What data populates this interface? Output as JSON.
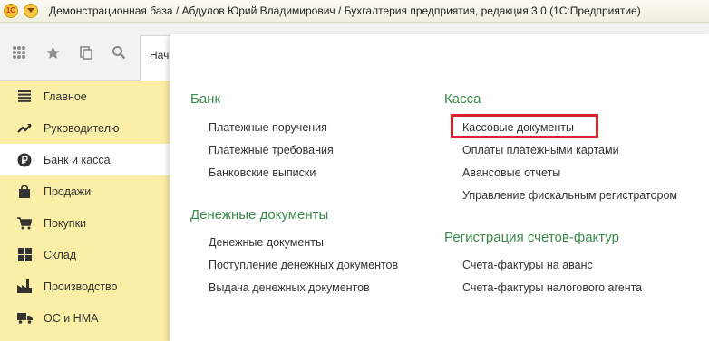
{
  "window": {
    "title": "Демонстрационная база / Абдулов Юрий Владимирович / Бухгалтерия предприятия, редакция 3.0  (1С:Предприятие)"
  },
  "toolbar": {
    "icons": [
      "apps-grid-icon",
      "star-icon",
      "history-icon",
      "search-icon"
    ],
    "tab_label": "Нач"
  },
  "sidebar": {
    "items": [
      {
        "label": "Главное",
        "icon": "menu-lines-icon"
      },
      {
        "label": "Руководителю",
        "icon": "trend-up-icon"
      },
      {
        "label": "Банк и касса",
        "icon": "ruble-coin-icon",
        "active": true
      },
      {
        "label": "Продажи",
        "icon": "shopping-bag-icon"
      },
      {
        "label": "Покупки",
        "icon": "cart-icon"
      },
      {
        "label": "Склад",
        "icon": "warehouse-icon"
      },
      {
        "label": "Производство",
        "icon": "factory-icon"
      },
      {
        "label": "ОС и НМА",
        "icon": "truck-icon"
      }
    ]
  },
  "panel": {
    "bank": {
      "title": "Банк",
      "links": [
        "Платежные поручения",
        "Платежные требования",
        "Банковские выписки"
      ]
    },
    "money_docs": {
      "title": "Денежные документы",
      "links": [
        "Денежные документы",
        "Поступление денежных документов",
        "Выдача денежных документов"
      ]
    },
    "cash": {
      "title": "Касса",
      "links": [
        "Кассовые документы",
        "Оплаты платежными картами",
        "Авансовые отчеты",
        "Управление фискальным регистратором"
      ],
      "highlighted": "Кассовые документы"
    },
    "invoices": {
      "title": "Регистрация счетов-фактур",
      "links": [
        "Счета-фактуры на аванс",
        "Счета-фактуры налогового агента"
      ]
    }
  },
  "colors": {
    "sidebar_bg": "#fbeea6",
    "section_title": "#3a8a4d",
    "highlight_border": "#d9242b"
  }
}
